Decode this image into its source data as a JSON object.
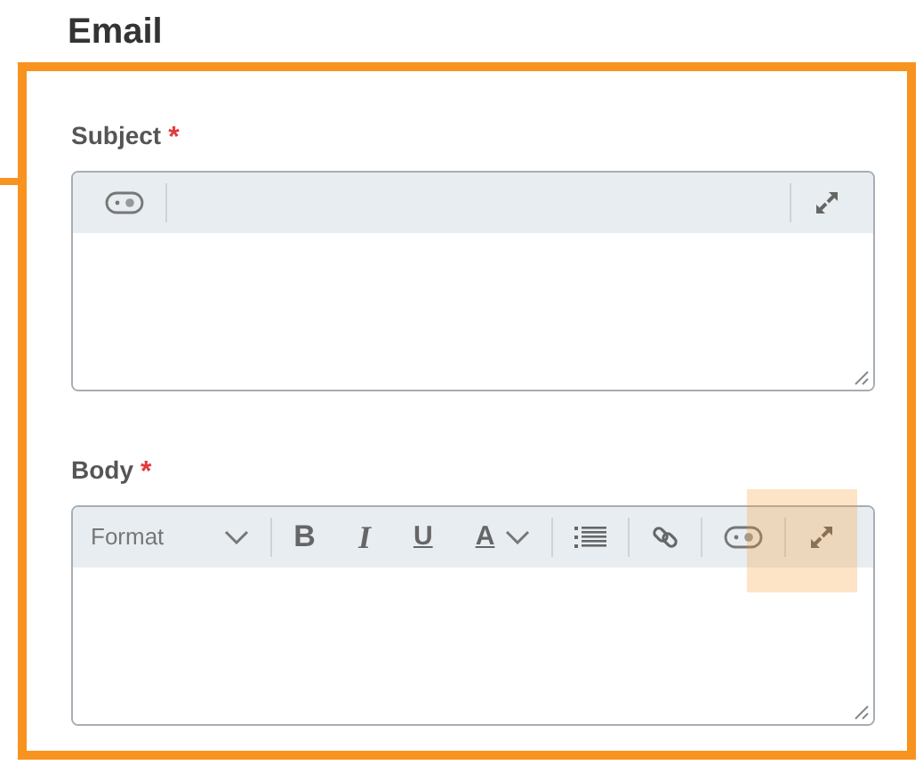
{
  "heading": "Email",
  "fields": [
    {
      "label": "Subject",
      "required_mark": "*",
      "tools": [
        {
          "kind": "tag",
          "highlighted": false
        },
        {
          "kind": "spacer"
        },
        {
          "kind": "expand",
          "highlighted": false
        }
      ]
    },
    {
      "label": "Body",
      "required_mark": "*",
      "tools": [
        {
          "kind": "dropdown",
          "label": "Format"
        },
        {
          "kind": "bold",
          "label": "B"
        },
        {
          "kind": "italic",
          "label": "I"
        },
        {
          "kind": "underline",
          "label": "U"
        },
        {
          "kind": "color",
          "label": "A"
        },
        {
          "kind": "list"
        },
        {
          "kind": "link"
        },
        {
          "kind": "tag",
          "highlighted": false
        },
        {
          "kind": "expand",
          "highlighted": true
        }
      ]
    }
  ]
}
